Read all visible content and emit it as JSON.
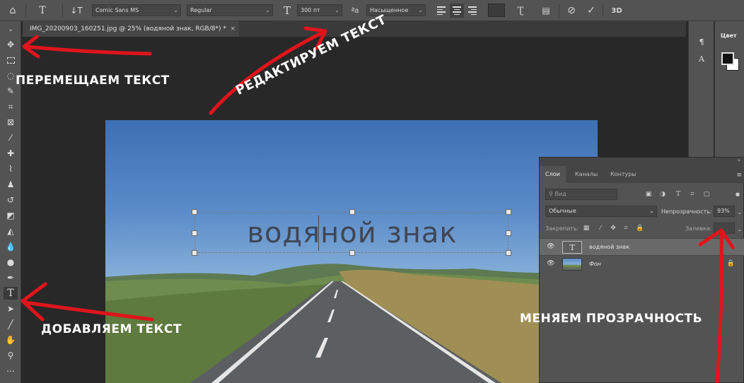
{
  "options_bar": {
    "font_family": "Comic Sans MS",
    "font_style": "Regular",
    "font_size": "300 пт",
    "antialias_icon_label": "aa",
    "antialias": "Насыщенное"
  },
  "document": {
    "tab_title": "IMG_20200903_160251.jpg @ 25% (водяной знак, RGB/8*) *",
    "close_glyph": "×"
  },
  "canvas": {
    "watermark_text": "водяной знак"
  },
  "color_panel": {
    "title": "Цвет"
  },
  "layers_panel": {
    "tabs": [
      "Слои",
      "Каналы",
      "Контуры"
    ],
    "search_placeholder": "Вид",
    "blend_mode": "Обычные",
    "opacity_label": "Непрозрачность:",
    "opacity_value": "93%",
    "lock_label": "Закрепить:",
    "fill_label": "Заливка:",
    "layers": [
      {
        "name": "водяной знак",
        "type": "text",
        "selected": true
      },
      {
        "name": "Фон",
        "type": "image",
        "selected": false
      }
    ]
  },
  "annotations": {
    "move_text": "ПЕРЕМЕЩАЕМ ТЕКСТ",
    "edit_text": "РЕДАКТИРУЕМ ТЕКСТ",
    "add_text": "ДОБАВЛЯЕМ ТЕКСТ",
    "change_opacity": "МЕНЯЕМ ПРОЗРАЧНОСТЬ"
  },
  "colors": {
    "arrow_red": "#e0141b",
    "panel_gray": "#535353",
    "workspace": "#282828"
  }
}
